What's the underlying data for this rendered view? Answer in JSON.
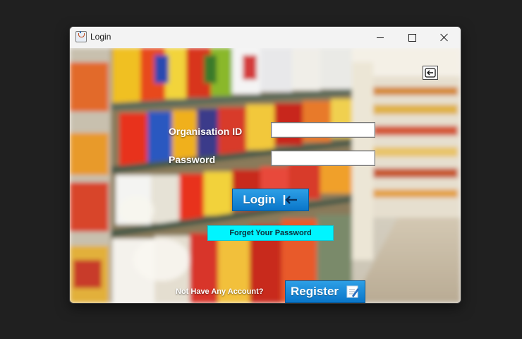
{
  "window": {
    "title": "Login",
    "controls": {
      "minimize": "minimize",
      "maximize": "maximize",
      "close": "close"
    }
  },
  "form": {
    "organisation_label": "Organisation ID",
    "organisation_value": "",
    "password_label": "Password",
    "password_value": "",
    "login_label": "Login",
    "forgot_label": "Forget Your Password",
    "no_account_label": "Not Have Any Account?",
    "register_label": "Register"
  },
  "icons": {
    "exit": "exit-icon",
    "login": "login-arrow-icon",
    "register": "register-notepad-icon",
    "app": "java-cup-icon"
  },
  "colors": {
    "primary_button": "#1488d8",
    "forgot_button": "#00f5ff",
    "desktop_bg": "#202020",
    "titlebar_bg": "#f3f3f3"
  }
}
